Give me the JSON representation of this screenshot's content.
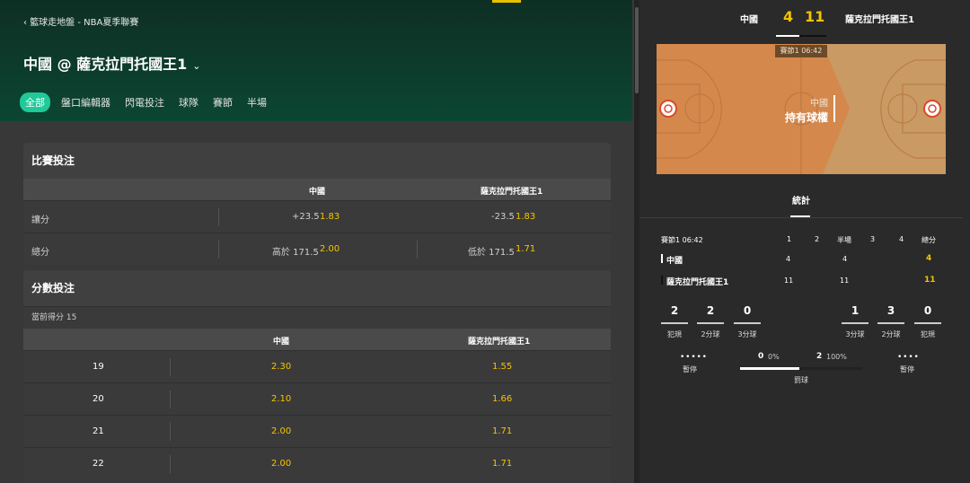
{
  "header": {
    "breadcrumb": "籃球走地盤 - NBA夏季聯賽",
    "breadcrumb_icon": "chevron-left-icon",
    "match_title": "中國 @ 薩克拉門托國王1",
    "title_icon": "chevron-down-icon",
    "tabs": [
      "全部",
      "盤口編輯器",
      "閃電投注",
      "球隊",
      "賽節",
      "半場"
    ],
    "active_tab": "全部"
  },
  "match_bet": {
    "title": "比賽投注",
    "col_a": "中國",
    "col_b": "薩克拉門托國王1",
    "rows": [
      {
        "label": "讓分",
        "a_line": "+23.5",
        "a_odds": "1.83",
        "b_line": "-23.5",
        "b_odds": "1.83"
      },
      {
        "label": "總分",
        "a_line": "高於 171.5",
        "a_odds": "2.00",
        "b_line": "低於 171.5",
        "b_odds": "1.71"
      }
    ]
  },
  "score_bet": {
    "title": "分數投注",
    "current": "當前得分 15",
    "col_a": "中國",
    "col_b": "薩克拉門托國王1",
    "rows": [
      {
        "score": "19",
        "a": "2.30",
        "b": "1.55"
      },
      {
        "score": "20",
        "a": "2.10",
        "b": "1.66"
      },
      {
        "score": "21",
        "a": "2.00",
        "b": "1.71"
      },
      {
        "score": "22",
        "a": "2.00",
        "b": "1.71"
      }
    ]
  },
  "scoreboard": {
    "team_a": "中國",
    "score_a": "4",
    "score_b": "11",
    "team_b": "薩克拉門托國王1",
    "period_badge": "賽節1  06:42",
    "possession_team": "中國",
    "possession_text": "持有球權"
  },
  "stats": {
    "tab": "統計",
    "period_clock": "賽節1 06:42",
    "columns": [
      "1",
      "2",
      "半場",
      "3",
      "4",
      "總分"
    ],
    "team_rows": [
      {
        "name": "中國",
        "q1": "4",
        "half": "4",
        "total": "4"
      },
      {
        "name": "薩克拉門托國王1",
        "q1": "11",
        "half": "11",
        "total": "11"
      }
    ],
    "team_a_stats": [
      {
        "value": "2",
        "label": "犯規"
      },
      {
        "value": "2",
        "label": "2分球"
      },
      {
        "value": "0",
        "label": "3分球"
      }
    ],
    "team_b_stats": [
      {
        "value": "1",
        "label": "3分球"
      },
      {
        "value": "3",
        "label": "2分球"
      },
      {
        "value": "0",
        "label": "犯規"
      }
    ],
    "timeout_label": "暫停",
    "timeout_a_dots": "• • • • •",
    "timeout_b_dots": "• • • •",
    "free_throw": {
      "a_value": "0",
      "a_pct": "0%",
      "b_value": "2",
      "b_pct": "100%",
      "label": "罰球"
    }
  },
  "colors": {
    "accent": "#20c997",
    "odds": "#f5c400",
    "header_bg": "#0b4632",
    "court": "#d98c4c"
  }
}
